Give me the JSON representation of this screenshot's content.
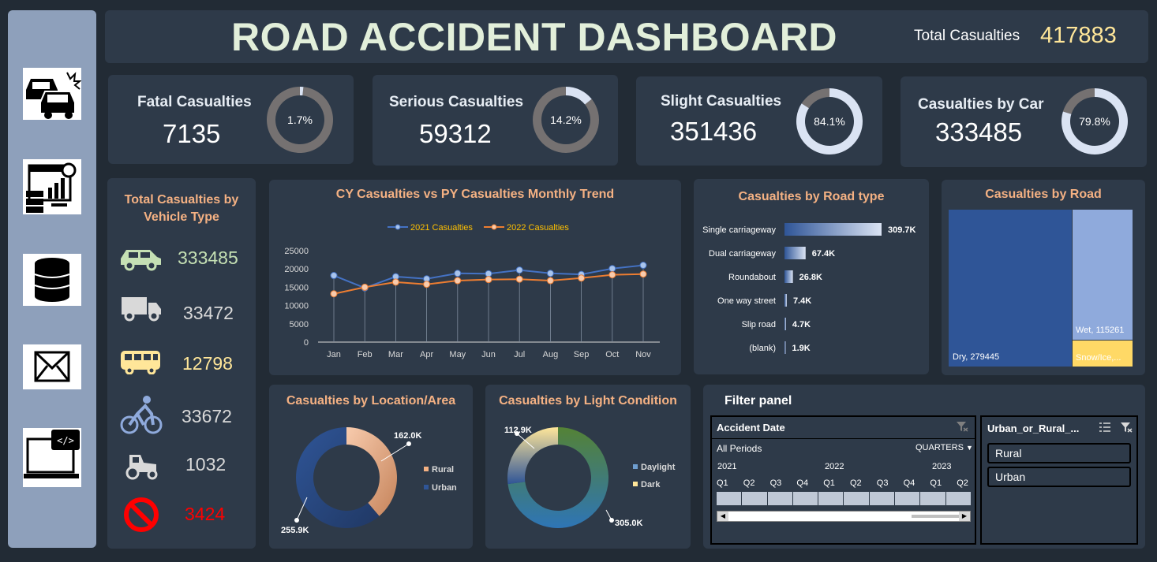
{
  "header": {
    "title": "ROAD ACCIDENT DASHBOARD",
    "total_label": "Total Casualties",
    "total_value": "417883"
  },
  "sidebar": {
    "icons": [
      "car-crash-icon",
      "dashboard-settings-icon",
      "database-icon",
      "mail-icon",
      "laptop-code-icon"
    ]
  },
  "kpis": [
    {
      "label": "Fatal Casualties",
      "value": "7135",
      "pct_label": "1.7%",
      "pct": 1.7
    },
    {
      "label": "Serious Casualties",
      "value": "59312",
      "pct_label": "14.2%",
      "pct": 14.2
    },
    {
      "label": "Slight Casualties",
      "value": "351436",
      "pct_label": "84.1%",
      "pct": 84.1
    },
    {
      "label": "Casualties by Car",
      "value": "333485",
      "pct_label": "79.8%",
      "pct": 79.8
    }
  ],
  "vehicle": {
    "title_line1": "Total Casualties by",
    "title_line2": "Vehicle Type",
    "items": [
      {
        "icon": "car-icon",
        "value": "333485",
        "color": "#c5e0b4"
      },
      {
        "icon": "truck-icon",
        "value": "33472",
        "color": "#d9d9d9"
      },
      {
        "icon": "bus-icon",
        "value": "12798",
        "color": "#ffe699"
      },
      {
        "icon": "bicycle-icon",
        "value": "33672",
        "color": "#d9d9d9"
      },
      {
        "icon": "tractor-icon",
        "value": "1032",
        "color": "#d9d9d9"
      },
      {
        "icon": "prohibited-icon",
        "value": "3424",
        "color": "#ff0000"
      }
    ]
  },
  "trend": {
    "title": "CY Casualties vs PY Casualties Monthly Trend",
    "legend_2021": "2021 Casualties",
    "legend_2022": "2022 Casualties"
  },
  "road_type": {
    "title": "Casualties by Road type"
  },
  "road_surface": {
    "title": "Casualties by Road",
    "dry_label": "Dry, 279445",
    "wet_label": "Wet, 115261",
    "snow_label": "Snow/Ice,..."
  },
  "location": {
    "title": "Casualties by Location/Area",
    "rural_label": "162.0K",
    "urban_label": "255.9K",
    "legend_rural": "Rural",
    "legend_urban": "Urban"
  },
  "light": {
    "title": "Casualties by Light Condition",
    "daylight_label": "305.0K",
    "dark_label": "112.9K",
    "legend_daylight": "Daylight",
    "legend_dark": "Dark"
  },
  "filter": {
    "title": "Filter panel",
    "date_slicer_title": "Accident Date",
    "all_periods": "All Periods",
    "quarters": "QUARTERS",
    "years": [
      "2021",
      "2022",
      "2023"
    ],
    "quarter_labels": [
      "Q1",
      "Q2",
      "Q3",
      "Q4",
      "Q1",
      "Q2",
      "Q3",
      "Q4",
      "Q1",
      "Q2"
    ],
    "urban_slicer_title": "Urban_or_Rural_...",
    "options": [
      "Rural",
      "Urban"
    ]
  },
  "colors": {
    "background": "#222b35",
    "panel": "#2e3a49",
    "accent_title": "#f4b183",
    "line_2021": "#4472c4",
    "line_2022": "#ed7d31"
  },
  "chart_data": [
    {
      "type": "line",
      "title": "CY Casualties vs PY Casualties Monthly Trend",
      "categories": [
        "Jan",
        "Feb",
        "Mar",
        "Apr",
        "May",
        "Jun",
        "Jul",
        "Aug",
        "Sep",
        "Oct",
        "Nov"
      ],
      "series": [
        {
          "name": "2021 Casualties",
          "values": [
            18200,
            14800,
            17900,
            17300,
            18800,
            18700,
            19700,
            18800,
            18500,
            20100,
            21000
          ]
        },
        {
          "name": "2022 Casualties",
          "values": [
            13200,
            15000,
            16400,
            15800,
            16800,
            17100,
            17200,
            16800,
            17500,
            18400,
            18600
          ]
        }
      ],
      "ylim": [
        0,
        25000
      ],
      "yticks": [
        0,
        5000,
        10000,
        15000,
        20000,
        25000
      ]
    },
    {
      "type": "bar",
      "title": "Casualties by Road type",
      "categories": [
        "Single carriageway",
        "Dual carriageway",
        "Roundabout",
        "One way street",
        "Slip road",
        "(blank)"
      ],
      "values": [
        309700,
        67400,
        26800,
        7400,
        4700,
        1900
      ],
      "labels": [
        "309.7K",
        "67.4K",
        "26.8K",
        "7.4K",
        "4.7K",
        "1.9K"
      ]
    },
    {
      "type": "treemap",
      "title": "Casualties by Road",
      "categories": [
        "Dry",
        "Wet",
        "Snow/Ice"
      ],
      "values": [
        279445,
        115261,
        23177
      ]
    },
    {
      "type": "pie",
      "title": "Casualties by Location/Area",
      "categories": [
        "Rural",
        "Urban"
      ],
      "values": [
        162000,
        255900
      ]
    },
    {
      "type": "pie",
      "title": "Casualties by Light Condition",
      "categories": [
        "Daylight",
        "Dark"
      ],
      "values": [
        305000,
        112900
      ]
    }
  ]
}
